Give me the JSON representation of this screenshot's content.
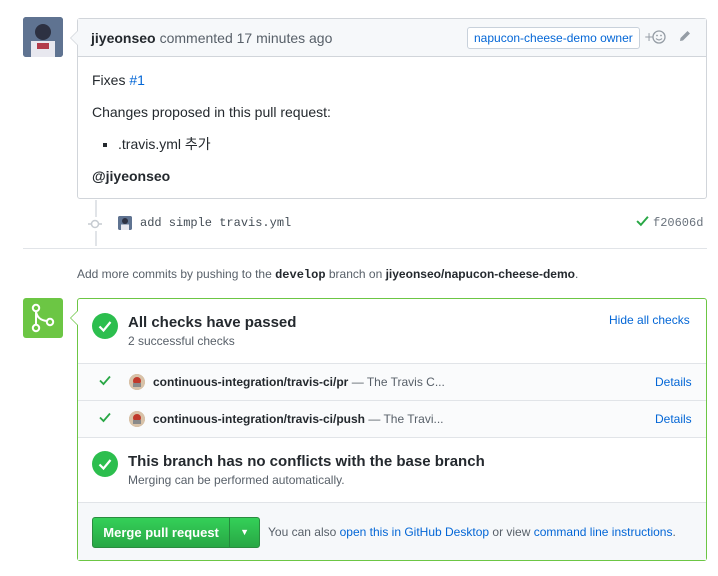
{
  "comment": {
    "author": "jiyeonseo",
    "action": "commented",
    "time": "17 minutes ago",
    "badge": "napucon-cheese-demo owner",
    "body": {
      "fixes_prefix": "Fixes",
      "issue_link": "#1",
      "changes_heading": "Changes proposed in this pull request:",
      "list_items": [
        ".travis.yml 추가"
      ],
      "mention": "@jiyeonseo"
    }
  },
  "commit": {
    "message": "add simple travis.yml",
    "sha": "f20606d"
  },
  "push_note": {
    "prefix": "Add more commits by pushing to the",
    "branch": "develop",
    "middle": "branch on",
    "repo": "jiyeonseo/napucon-cheese-demo",
    "suffix": "."
  },
  "checks": {
    "title": "All checks have passed",
    "subtitle": "2 successful checks",
    "toggle_label": "Hide all checks",
    "items": [
      {
        "name": "continuous-integration/travis-ci/pr",
        "description": "— The Travis C...",
        "details": "Details"
      },
      {
        "name": "continuous-integration/travis-ci/push",
        "description": "— The Travi...",
        "details": "Details"
      }
    ]
  },
  "conflicts": {
    "title": "This branch has no conflicts with the base branch",
    "subtitle": "Merging can be performed automatically."
  },
  "merge": {
    "button_label": "Merge pull request",
    "note_prefix": "You can also",
    "desktop_link": "open this in GitHub Desktop",
    "note_middle": "or view",
    "cli_link": "command line instructions",
    "note_suffix": "."
  },
  "colors": {
    "success_green": "#2cbe4e",
    "merge_green": "#6cc644",
    "link_blue": "#0366d6"
  },
  "icons": {
    "emoji": "smiley-icon",
    "edit": "pencil-icon",
    "check": "check-icon",
    "merge": "git-merge-icon",
    "commit": "git-commit-icon",
    "dropdown": "triangle-down-icon"
  }
}
